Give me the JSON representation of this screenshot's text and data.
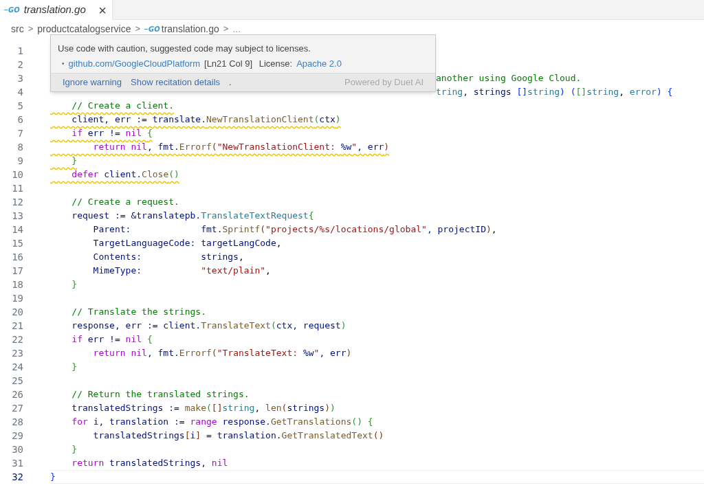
{
  "tab": {
    "icon_text": "GO",
    "title": "translation.go",
    "close": "×",
    "selected": true
  },
  "breadcrumb": [
    {
      "label": "src",
      "kind": "folder"
    },
    {
      "label": "productcatalogservice",
      "kind": "folder"
    },
    {
      "label": "translation.go",
      "kind": "file",
      "icon_text": "GO"
    },
    {
      "label": "...",
      "kind": "more"
    }
  ],
  "breadcrumb_separator": ">",
  "popup": {
    "message": "Use code with caution, suggested code may subject to licenses.",
    "bullet": "•",
    "source_link": "github.com/GoogleCloudPlatform",
    "location": "[Ln21 Col 9]",
    "license_label": "License:",
    "license_link": "Apache 2.0",
    "actions": [
      "Ignore warning",
      "Show recitation details"
    ],
    "separator": ".",
    "powered_by": "Powered by Duet AI"
  },
  "lines": [
    {
      "number": "1"
    },
    {
      "number": "2"
    },
    {
      "number": "3",
      "covered": true,
      "tokens": [
        {
          "text": "another using Google Cloud.",
          "kind": "c"
        }
      ]
    },
    {
      "number": "4",
      "covered": true,
      "tokens": [
        {
          "text": "tring",
          "kind": "t"
        },
        {
          "text": ", strings ",
          "kind": "v"
        },
        {
          "text": "[]",
          "kind": "b1"
        },
        {
          "text": "string",
          "kind": "t"
        },
        {
          "text": ") (",
          "kind": "b1"
        },
        {
          "text": "[]",
          "kind": "b2"
        },
        {
          "text": "string",
          "kind": "t"
        },
        {
          "text": ", ",
          "kind": "p"
        },
        {
          "text": "error",
          "kind": "t"
        },
        {
          "text": ") {",
          "kind": "b1"
        }
      ]
    },
    {
      "number": "5",
      "warned": true,
      "tokens": [
        {
          "text": "    // Create a client.",
          "kind": "c"
        }
      ]
    },
    {
      "number": "6",
      "warned": true,
      "tokens": [
        {
          "text": "    client, err := translate.",
          "kind": "v"
        },
        {
          "text": "NewTranslationClient",
          "kind": "f"
        },
        {
          "text": "(",
          "kind": "b2"
        },
        {
          "text": "ctx",
          "kind": "v"
        },
        {
          "text": ")",
          "kind": "b2"
        }
      ]
    },
    {
      "number": "7",
      "warned": true,
      "tokens": [
        {
          "text": "    if ",
          "kind": "k"
        },
        {
          "text": "err != ",
          "kind": "v"
        },
        {
          "text": "nil ",
          "kind": "k"
        },
        {
          "text": "{",
          "kind": "b2"
        }
      ]
    },
    {
      "number": "8",
      "warned": true,
      "tokens": [
        {
          "text": "        return nil",
          "kind": "k"
        },
        {
          "text": ", fmt.",
          "kind": "v"
        },
        {
          "text": "Errorf",
          "kind": "f"
        },
        {
          "text": "(",
          "kind": "b3"
        },
        {
          "text": "\"NewTranslationClient: ",
          "kind": "s"
        },
        {
          "text": "%w",
          "kind": "v"
        },
        {
          "text": "\"",
          "kind": "s"
        },
        {
          "text": ", err",
          "kind": "v"
        },
        {
          "text": ")",
          "kind": "b3"
        }
      ]
    },
    {
      "number": "9",
      "warned": true,
      "tokens": [
        {
          "text": "    }",
          "kind": "b2"
        }
      ]
    },
    {
      "number": "10",
      "warned": true,
      "tokens": [
        {
          "text": "    defer ",
          "kind": "k"
        },
        {
          "text": "client.",
          "kind": "v"
        },
        {
          "text": "Close",
          "kind": "f"
        },
        {
          "text": "()",
          "kind": "b2"
        }
      ]
    },
    {
      "number": "11"
    },
    {
      "number": "12",
      "tokens": [
        {
          "text": "    // Create a request.",
          "kind": "c"
        }
      ]
    },
    {
      "number": "13",
      "tokens": [
        {
          "text": "    request := &translatepb.",
          "kind": "v"
        },
        {
          "text": "TranslateTextRequest",
          "kind": "t"
        },
        {
          "text": "{",
          "kind": "b2"
        }
      ]
    },
    {
      "number": "14",
      "tokens": [
        {
          "text": "        Parent:             fmt.",
          "kind": "v"
        },
        {
          "text": "Sprintf",
          "kind": "f"
        },
        {
          "text": "(",
          "kind": "b3"
        },
        {
          "text": "\"projects/%s/locations/global\"",
          "kind": "s"
        },
        {
          "text": ", projectID",
          "kind": "v"
        },
        {
          "text": ")",
          "kind": "b3"
        },
        {
          "text": ",",
          "kind": "p"
        }
      ]
    },
    {
      "number": "15",
      "tokens": [
        {
          "text": "        TargetLanguageCode: targetLangCode",
          "kind": "v"
        },
        {
          "text": ",",
          "kind": "p"
        }
      ]
    },
    {
      "number": "16",
      "tokens": [
        {
          "text": "        Contents:           strings",
          "kind": "v"
        },
        {
          "text": ",",
          "kind": "p"
        }
      ]
    },
    {
      "number": "17",
      "tokens": [
        {
          "text": "        MimeType:           ",
          "kind": "v"
        },
        {
          "text": "\"text/plain\"",
          "kind": "s"
        },
        {
          "text": ",",
          "kind": "p"
        }
      ]
    },
    {
      "number": "18",
      "tokens": [
        {
          "text": "    }",
          "kind": "b2"
        }
      ]
    },
    {
      "number": "19"
    },
    {
      "number": "20",
      "tokens": [
        {
          "text": "    // Translate the strings.",
          "kind": "c"
        }
      ]
    },
    {
      "number": "21",
      "tokens": [
        {
          "text": "    response, err := client.",
          "kind": "v"
        },
        {
          "text": "TranslateText",
          "kind": "f"
        },
        {
          "text": "(",
          "kind": "b2"
        },
        {
          "text": "ctx, request",
          "kind": "v"
        },
        {
          "text": ")",
          "kind": "b2"
        }
      ]
    },
    {
      "number": "22",
      "tokens": [
        {
          "text": "    if ",
          "kind": "k"
        },
        {
          "text": "err != ",
          "kind": "v"
        },
        {
          "text": "nil ",
          "kind": "k"
        },
        {
          "text": "{",
          "kind": "b2"
        }
      ]
    },
    {
      "number": "23",
      "tokens": [
        {
          "text": "        return nil",
          "kind": "k"
        },
        {
          "text": ", fmt.",
          "kind": "v"
        },
        {
          "text": "Errorf",
          "kind": "f"
        },
        {
          "text": "(",
          "kind": "b3"
        },
        {
          "text": "\"TranslateText: ",
          "kind": "s"
        },
        {
          "text": "%w",
          "kind": "v"
        },
        {
          "text": "\"",
          "kind": "s"
        },
        {
          "text": ", err",
          "kind": "v"
        },
        {
          "text": ")",
          "kind": "b3"
        }
      ]
    },
    {
      "number": "24",
      "tokens": [
        {
          "text": "    }",
          "kind": "b2"
        }
      ]
    },
    {
      "number": "25"
    },
    {
      "number": "26",
      "tokens": [
        {
          "text": "    // Return the translated strings.",
          "kind": "c"
        }
      ]
    },
    {
      "number": "27",
      "tokens": [
        {
          "text": "    translatedStrings := ",
          "kind": "v"
        },
        {
          "text": "make",
          "kind": "f"
        },
        {
          "text": "(",
          "kind": "b2"
        },
        {
          "text": "[]",
          "kind": "b3"
        },
        {
          "text": "string",
          "kind": "t"
        },
        {
          "text": ", ",
          "kind": "p"
        },
        {
          "text": "len",
          "kind": "f"
        },
        {
          "text": "(",
          "kind": "b3"
        },
        {
          "text": "strings",
          "kind": "v"
        },
        {
          "text": ")",
          "kind": "b3"
        },
        {
          "text": ")",
          "kind": "b2"
        }
      ]
    },
    {
      "number": "28",
      "tokens": [
        {
          "text": "    for ",
          "kind": "k"
        },
        {
          "text": "i, translation := ",
          "kind": "v"
        },
        {
          "text": "range ",
          "kind": "k"
        },
        {
          "text": "response.",
          "kind": "v"
        },
        {
          "text": "GetTranslations",
          "kind": "f"
        },
        {
          "text": "() {",
          "kind": "b2"
        }
      ]
    },
    {
      "number": "29",
      "tokens": [
        {
          "text": "        translatedStrings",
          "kind": "v"
        },
        {
          "text": "[",
          "kind": "b3"
        },
        {
          "text": "i",
          "kind": "v"
        },
        {
          "text": "]",
          "kind": "b3"
        },
        {
          "text": " = translation.",
          "kind": "v"
        },
        {
          "text": "GetTranslatedText",
          "kind": "f"
        },
        {
          "text": "()",
          "kind": "b3"
        }
      ]
    },
    {
      "number": "30",
      "tokens": [
        {
          "text": "    }",
          "kind": "b2"
        }
      ]
    },
    {
      "number": "31",
      "tokens": [
        {
          "text": "    return ",
          "kind": "k"
        },
        {
          "text": "translatedStrings, ",
          "kind": "v"
        },
        {
          "text": "nil",
          "kind": "k"
        }
      ]
    },
    {
      "number": "32",
      "current": true,
      "tokens": [
        {
          "text": "}",
          "kind": "b1"
        }
      ]
    }
  ]
}
